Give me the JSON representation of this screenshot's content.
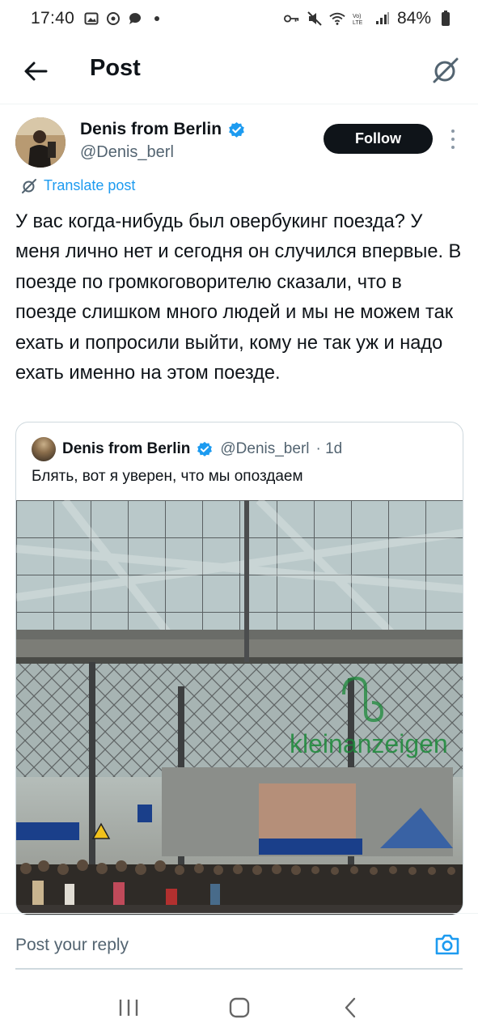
{
  "status_bar": {
    "time": "17:40",
    "battery": "84%"
  },
  "header": {
    "title": "Post"
  },
  "post": {
    "author_name": "Denis from Berlin",
    "author_handle": "@Denis_berl",
    "follow_label": "Follow",
    "translate_label": "Translate post",
    "text": "У вас когда-нибудь был овербукинг поезда? У меня лично нет и сегодня он случился впервые. В поезде по громкоговорителю сказали, что в поезде слишком много людей и мы не можем так ехать и попросили выйти, кому не так уж и надо ехать именно на этом поезде."
  },
  "quote": {
    "author_name": "Denis from Berlin",
    "author_handle": "@Denis_berl",
    "time": "· 1d",
    "text": "Блять, вот я уверен, что мы опоздаем",
    "image_watermark": "kleinanzeigen"
  },
  "reply": {
    "placeholder": "Post your reply"
  },
  "icons": {
    "back": "arrow-left-icon",
    "grok": "grok-icon",
    "verified": "verified-badge-icon",
    "camera": "camera-icon"
  },
  "colors": {
    "accent": "#1d9bf0",
    "text": "#0f1419",
    "secondary": "#536471"
  }
}
